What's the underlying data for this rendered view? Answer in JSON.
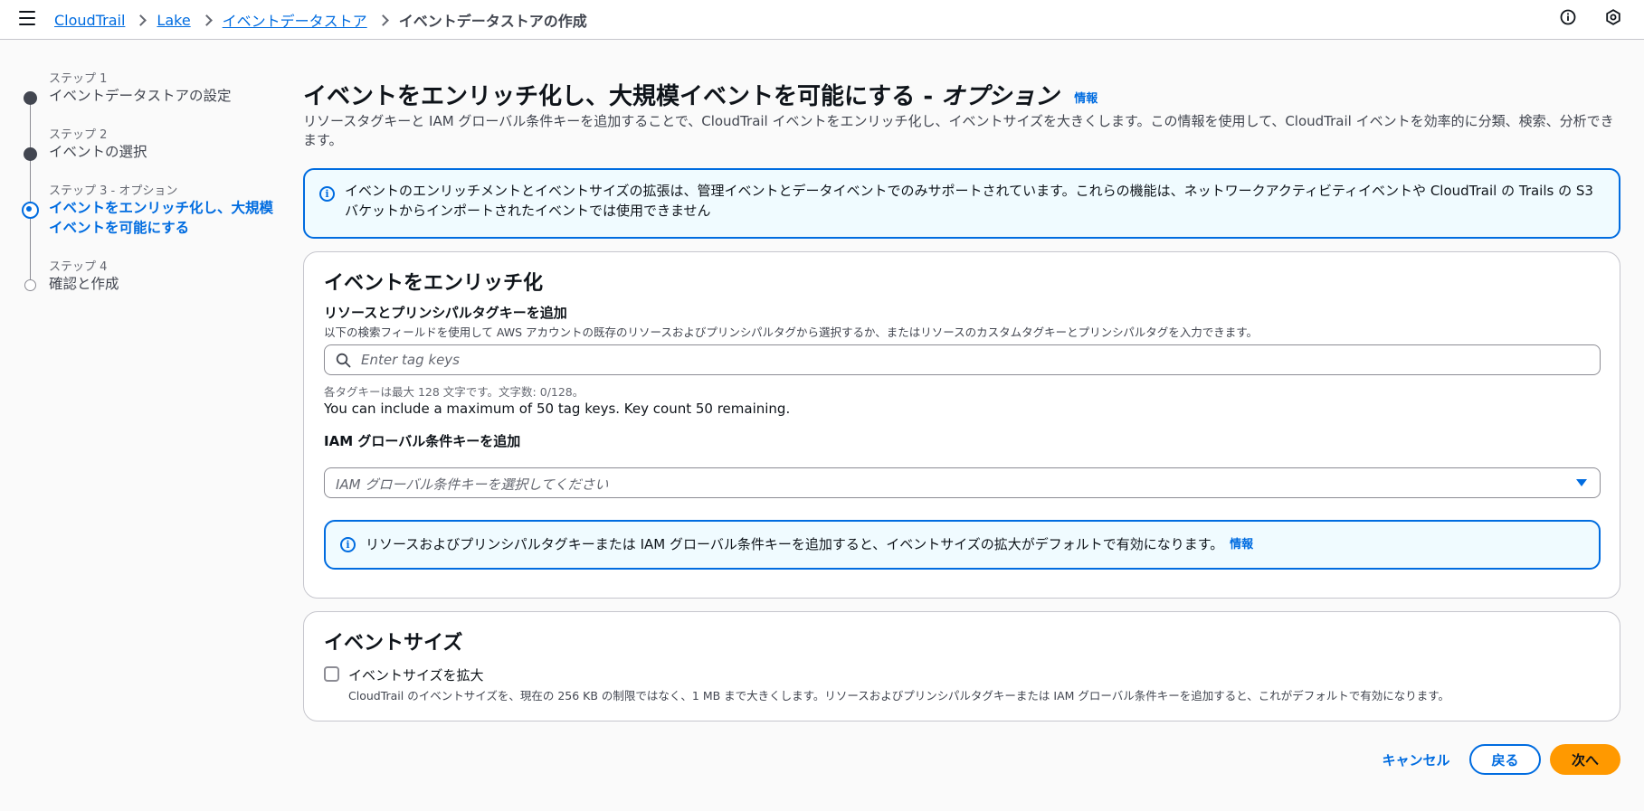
{
  "breadcrumb": {
    "items": [
      "CloudTrail",
      "Lake",
      "イベントデータストア"
    ],
    "current": "イベントデータストアの作成"
  },
  "steps": [
    {
      "number": "ステップ 1",
      "title": "イベントデータストアの設定",
      "state": "done"
    },
    {
      "number": "ステップ 2",
      "title": "イベントの選択",
      "state": "done"
    },
    {
      "number": "ステップ 3 - オプション",
      "title": "イベントをエンリッチ化し、大規模イベントを可能にする",
      "state": "active"
    },
    {
      "number": "ステップ 4",
      "title": "確認と作成",
      "state": "todo"
    }
  ],
  "page": {
    "title_main": "イベントをエンリッチ化し、大規模イベントを可能にする - ",
    "title_optional": "オプション",
    "info_label": "情報",
    "description": "リソースタグキーと IAM グローバル条件キーを追加することで、CloudTrail イベントをエンリッチ化し、イベントサイズを大きくします。この情報を使用して、CloudTrail イベントを効率的に分類、検索、分析できます。"
  },
  "top_alert": {
    "text": "イベントのエンリッチメントとイベントサイズの拡張は、管理イベントとデータイベントでのみサポートされています。これらの機能は、ネットワークアクティビティイベントや CloudTrail の Trails の S3 バケットからインポートされたイベントでは使用できません"
  },
  "enrich_section": {
    "title": "イベントをエンリッチ化",
    "tag_label": "リソースとプリンシパルタグキーを追加",
    "tag_desc": "以下の検索フィールドを使用して AWS アカウントの既存のリソースおよびプリンシパルタグから選択するか、またはリソースのカスタムタグキーとプリンシパルタグを入力できます。",
    "tag_placeholder": "Enter tag keys",
    "tag_hint": "各タグキーは最大 128 文字です。文字数: 0/128。",
    "tag_count": "You can include a maximum of 50 tag keys. Key count 50 remaining.",
    "iam_label": "IAM グローバル条件キーを追加",
    "iam_placeholder": "IAM グローバル条件キーを選択してください",
    "alert_text": "リソースおよびプリンシパルタグキーまたは IAM グローバル条件キーを追加すると、イベントサイズの拡大がデフォルトで有効になります。",
    "alert_info": "情報"
  },
  "size_section": {
    "title": "イベントサイズ",
    "checkbox_label": "イベントサイズを拡大",
    "checkbox_checked": false,
    "checkbox_desc": "CloudTrail のイベントサイズを、現在の 256 KB の制限ではなく、1 MB まで大きくします。リソースおよびプリンシパルタグキーまたは IAM グローバル条件キーを追加すると、これがデフォルトで有効になります。"
  },
  "actions": {
    "cancel": "キャンセル",
    "back": "戻る",
    "next": "次へ"
  },
  "colors": {
    "link": "#006ce0",
    "primary_button": "#ff9900",
    "alert_bg": "#f0fbff"
  }
}
